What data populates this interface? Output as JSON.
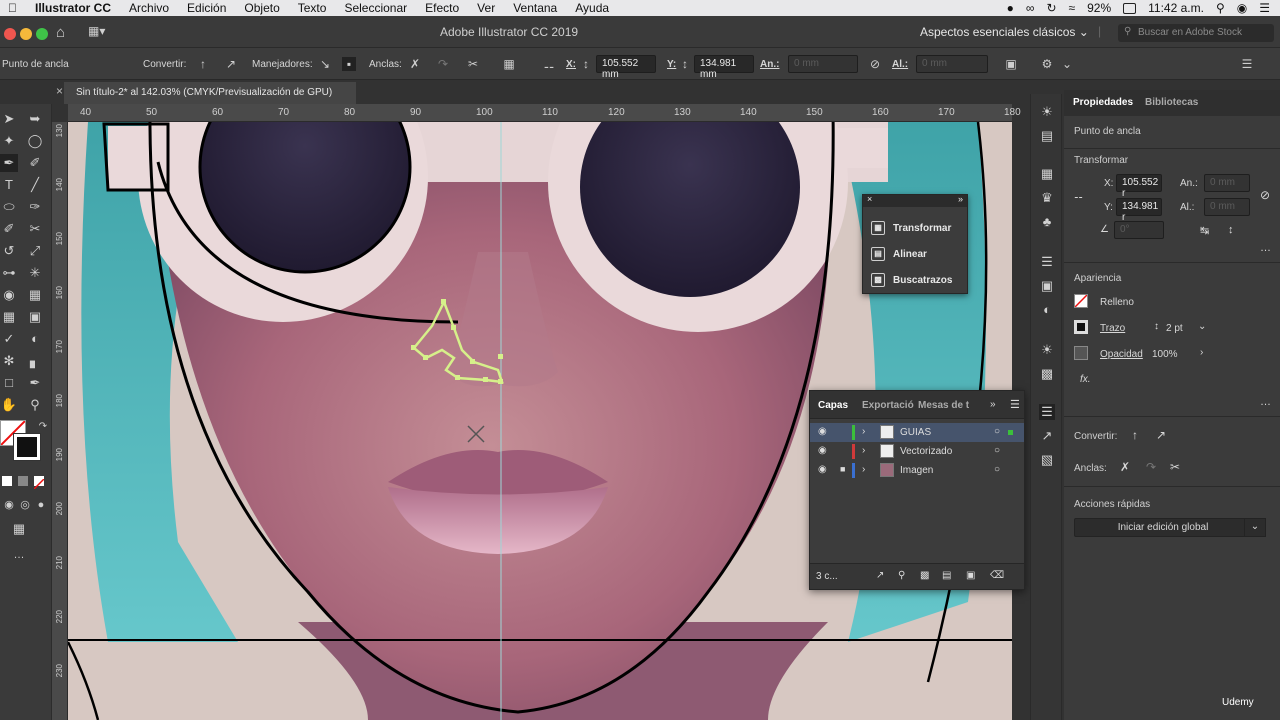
{
  "menubar": {
    "apple_icon": "apple-logo",
    "app_name": "Illustrator CC",
    "items": [
      "Archivo",
      "Edición",
      "Objeto",
      "Texto",
      "Seleccionar",
      "Efecto",
      "Ver",
      "Ventana",
      "Ayuda"
    ],
    "battery": "92%",
    "clock": "11:42 a.m."
  },
  "appheader": {
    "title": "Adobe Illustrator CC 2019",
    "workspace": "Aspectos esenciales clásicos",
    "search_placeholder": "Buscar en Adobe Stock"
  },
  "controlbar": {
    "context": "Punto de ancla",
    "convert_label": "Convertir:",
    "handles_label": "Manejadores:",
    "anchors_label": "Anclas:",
    "x_label": "X:",
    "x_value": "105.552 mm",
    "y_label": "Y:",
    "y_value": "134.981 mm",
    "width_label": "An.:",
    "width_value": "0 mm",
    "height_label": "Al.:",
    "height_value": "0 mm"
  },
  "document": {
    "tab_title": "Sin título-2* al 142.03% (CMYK/Previsualización de GPU)",
    "h_ruler_ticks": [
      "40",
      "50",
      "60",
      "70",
      "80",
      "90",
      "100",
      "110",
      "120",
      "130",
      "140",
      "150",
      "160",
      "170",
      "180"
    ],
    "v_ruler_ticks": [
      "130",
      "140",
      "150",
      "160",
      "170",
      "180",
      "190",
      "200",
      "210",
      "220",
      "230"
    ]
  },
  "floating_panel": {
    "items": [
      "Transformar",
      "Alinear",
      "Buscatrazos"
    ]
  },
  "layers_panel": {
    "tabs": [
      "Capas",
      "Exportació",
      "Mesas de t"
    ],
    "layers": [
      {
        "name": "GUIAS",
        "color": "#3bbf3b"
      },
      {
        "name": "Vectorizado",
        "color": "#d03a3a"
      },
      {
        "name": "Imagen",
        "color": "#3a6fd0"
      }
    ],
    "footer_count": "3 c..."
  },
  "properties": {
    "tabs": [
      "Propiedades",
      "Bibliotecas"
    ],
    "context": "Punto de ancla",
    "transform_title": "Transformar",
    "x_label": "X:",
    "x_value": "105.552 r",
    "y_label": "Y:",
    "y_value": "134.981 r",
    "w_label": "An.:",
    "w_value": "0 mm",
    "h_label": "Al.:",
    "h_value": "0 mm",
    "angle_value": "0°",
    "appearance_title": "Apariencia",
    "fill_label": "Relleno",
    "stroke_label": "Trazo",
    "stroke_value": "2 pt",
    "opacity_label": "Opacidad",
    "opacity_value": "100%",
    "fx_label": "fx.",
    "convert_label": "Convertir:",
    "anchors_label": "Anclas:",
    "quick_actions_title": "Acciones rápidas",
    "global_edit_button": "Iniciar edición global"
  },
  "watermark": "Udemy"
}
